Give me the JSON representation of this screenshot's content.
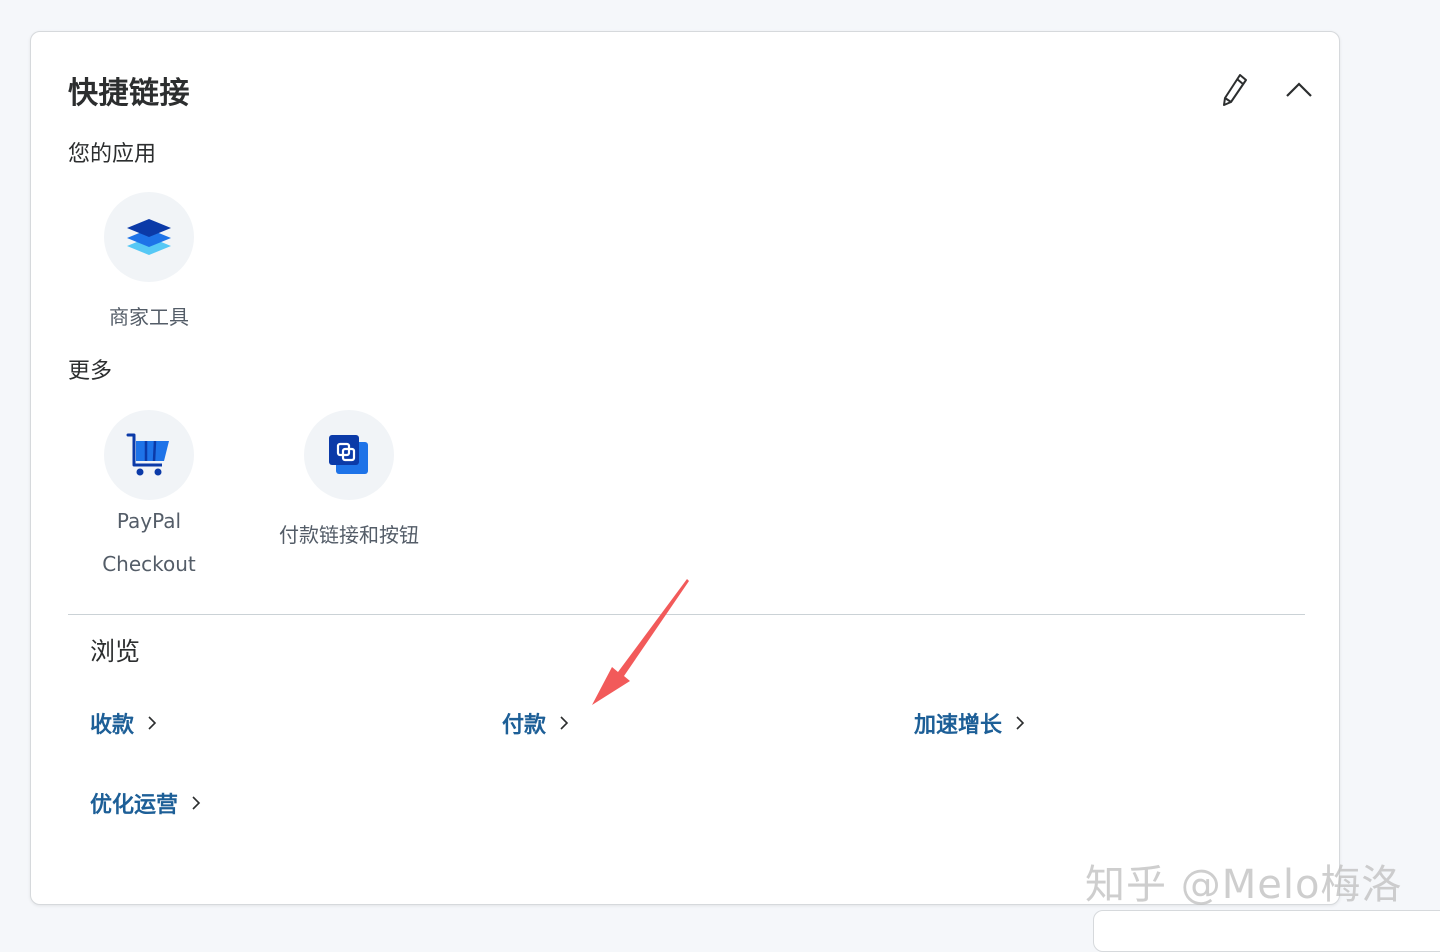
{
  "quick_links": {
    "title": "快捷链接",
    "edit_icon": "pencil-icon",
    "collapse_icon": "chevron-up-icon"
  },
  "your_apps": {
    "label": "您的应用",
    "items": [
      {
        "label": "商家工具",
        "icon": "layers-icon"
      }
    ]
  },
  "more": {
    "label": "更多",
    "items": [
      {
        "label_line1": "PayPal",
        "label_line2": "Checkout",
        "icon": "cart-icon"
      },
      {
        "label": "付款链接和按钮",
        "icon": "link-buttons-icon"
      }
    ]
  },
  "browse": {
    "label": "浏览",
    "links": [
      "收款",
      "付款",
      "加速增长",
      "优化运营"
    ]
  },
  "watermark": "知乎 @Melo梅洛",
  "colors": {
    "link": "#1d5f97",
    "annotation_arrow": "#f25a5a",
    "icon_dark": "#0b3aa8",
    "icon_light": "#56c8f5"
  }
}
